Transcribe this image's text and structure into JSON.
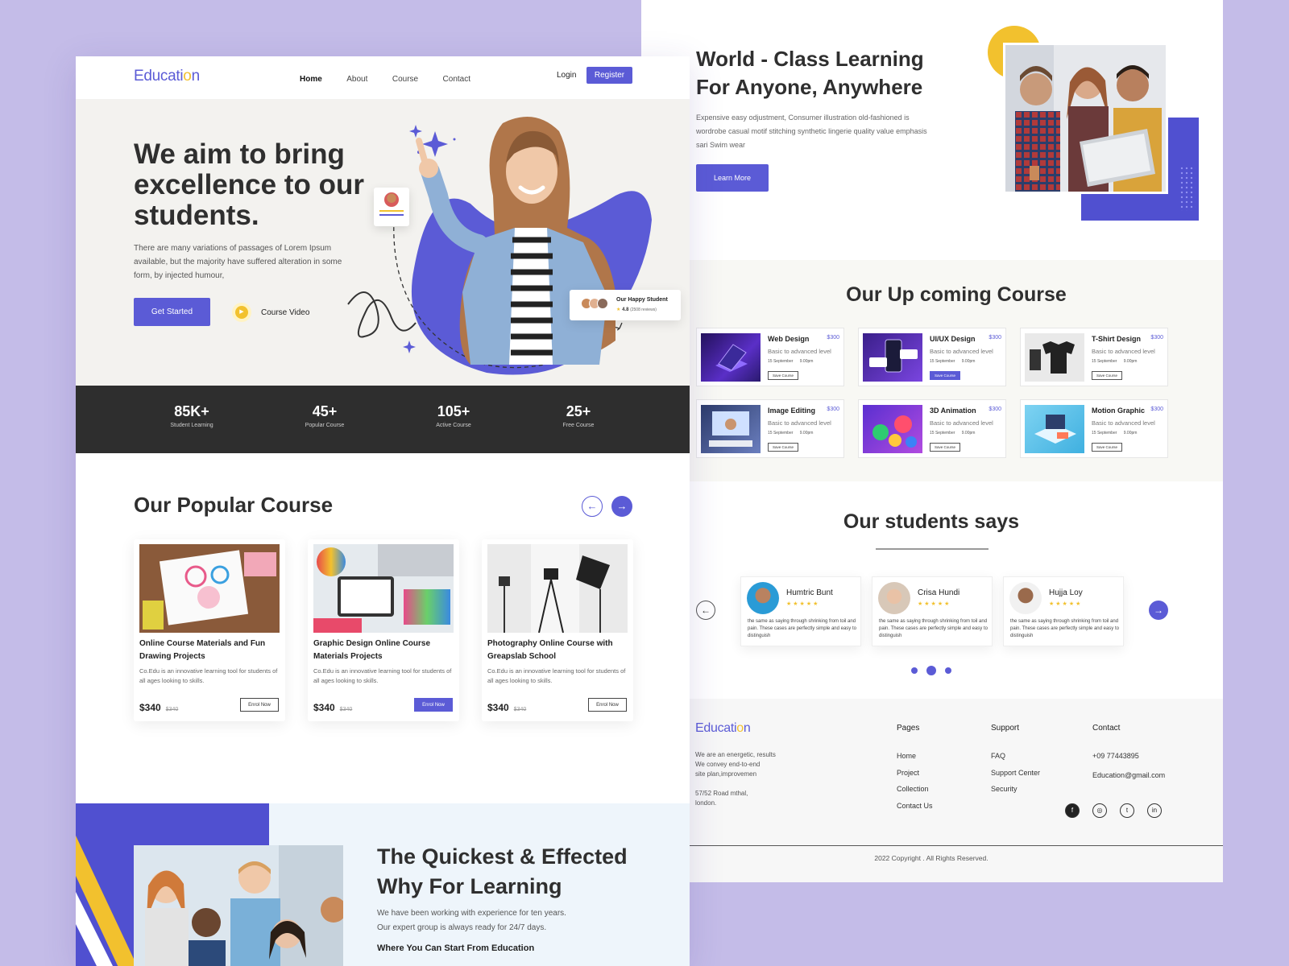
{
  "brand": {
    "logo_text": "Educati",
    "logo_dot": "o",
    "logo_end": "n"
  },
  "nav": {
    "links": [
      "Home",
      "About",
      "Course",
      "Contact"
    ],
    "login": "Login",
    "register": "Register"
  },
  "hero": {
    "title_line1": "We aim to bring",
    "title_line2": "excellence to our",
    "title_line3": "students.",
    "description": "There are many variations of passages of Lorem Ipsum available, but the majority have suffered alteration in some form, by injected humour,",
    "cta": "Get Started",
    "video_label": "Course Video",
    "happy_student": "Our Happy Student",
    "rating": "4.8",
    "reviews": "(2508 reviews)"
  },
  "stats": [
    {
      "value": "85K+",
      "label": "Student Learning"
    },
    {
      "value": "45+",
      "label": "Popular Course"
    },
    {
      "value": "105+",
      "label": "Active Course"
    },
    {
      "value": "25+",
      "label": "Free Course"
    }
  ],
  "popular": {
    "title": "Our Popular Course",
    "courses": [
      {
        "title": "Online Course Materials and Fun Drawing Projects",
        "desc": "Co.Edu  is an innovative learning tool for students of all ages looking to skills.",
        "price": "$340",
        "old_price": "$340",
        "button": "Enrol Now"
      },
      {
        "title": "Graphic Design Online Course Materials Projects",
        "desc": "Co.Edu  is an innovative learning tool for students of all ages looking to skills.",
        "price": "$340",
        "old_price": "$340",
        "button": "Enrol Now"
      },
      {
        "title": "Photography Online Course with Greapslab School",
        "desc": "Co.Edu  is an innovative learning tool for students of all ages looking to skills.",
        "price": "$340",
        "old_price": "$340",
        "button": "Enrol Now"
      }
    ]
  },
  "quick": {
    "title_line1": "The Quickest & Effected",
    "title_line2": "Why For Learning",
    "desc_line1": "We have been working with experience for ten years.",
    "desc_line2": "Our expert group is always ready for 24/7 days.",
    "subhead": "Where You Can Start From Education"
  },
  "world": {
    "title_line1": "World - Class Learning",
    "title_line2": "For Anyone, Anywhere",
    "desc": "Expensive easy odjustment, Consumer illustration old-fashioned is wordrobe casual motif stitching synthetic lingerie quality value emphasis sari Swim wear",
    "button": "Learn More"
  },
  "upcoming": {
    "title": "Our Up  coming Course",
    "level": "Basic to advanced level",
    "date": "15 September",
    "time": "9.00pm",
    "save": "Save Course",
    "courses": [
      {
        "name": "Web Design",
        "price": "$300"
      },
      {
        "name": "UI/UX Design",
        "price": "$300"
      },
      {
        "name": "T-Shirt Design",
        "price": "$300"
      },
      {
        "name": "Image Editing",
        "price": "$300"
      },
      {
        "name": "3D Animation",
        "price": "$300"
      },
      {
        "name": "Motion Graphic",
        "price": "$300"
      }
    ]
  },
  "testimonials": {
    "title": "Our students says",
    "stars": "★★★★★",
    "items": [
      {
        "name": "Humtric Bunt",
        "text": "the same as saying through shrinking from toil and pain. These cases are perfectly simple and easy to distinguish"
      },
      {
        "name": "Crisa Hundi",
        "text": "the same as saying through shrinking from toil and pain. These cases are perfectly simple and easy to distinguish"
      },
      {
        "name": "Hujja Loy",
        "text": "the same as saying through shrinking from toil and pain. These cases are perfectly simple and easy to distinguish"
      }
    ]
  },
  "footer": {
    "about_line1": "We are an energetic, results",
    "about_line2": "We convey end-to-end",
    "about_line3": "site plan,improvemen",
    "address_line1": "57/52 Road mthal,",
    "address_line2": "london.",
    "pages_title": "Pages",
    "pages": [
      "Home",
      "Project",
      "Collection",
      "Contact Us"
    ],
    "support_title": "Support",
    "support": [
      "FAQ",
      "Support Center",
      "Security"
    ],
    "contact_title": "Contact",
    "phone": "+09 77443895",
    "email": "Education@gmail.com",
    "social": [
      "f",
      "◎",
      "t",
      "in"
    ],
    "copyright": "2022 Copyright . All Rights Reserved."
  },
  "colors": {
    "accent": "#5b5bd6",
    "yellow": "#f2c12e",
    "dark": "#2e2e2e"
  }
}
